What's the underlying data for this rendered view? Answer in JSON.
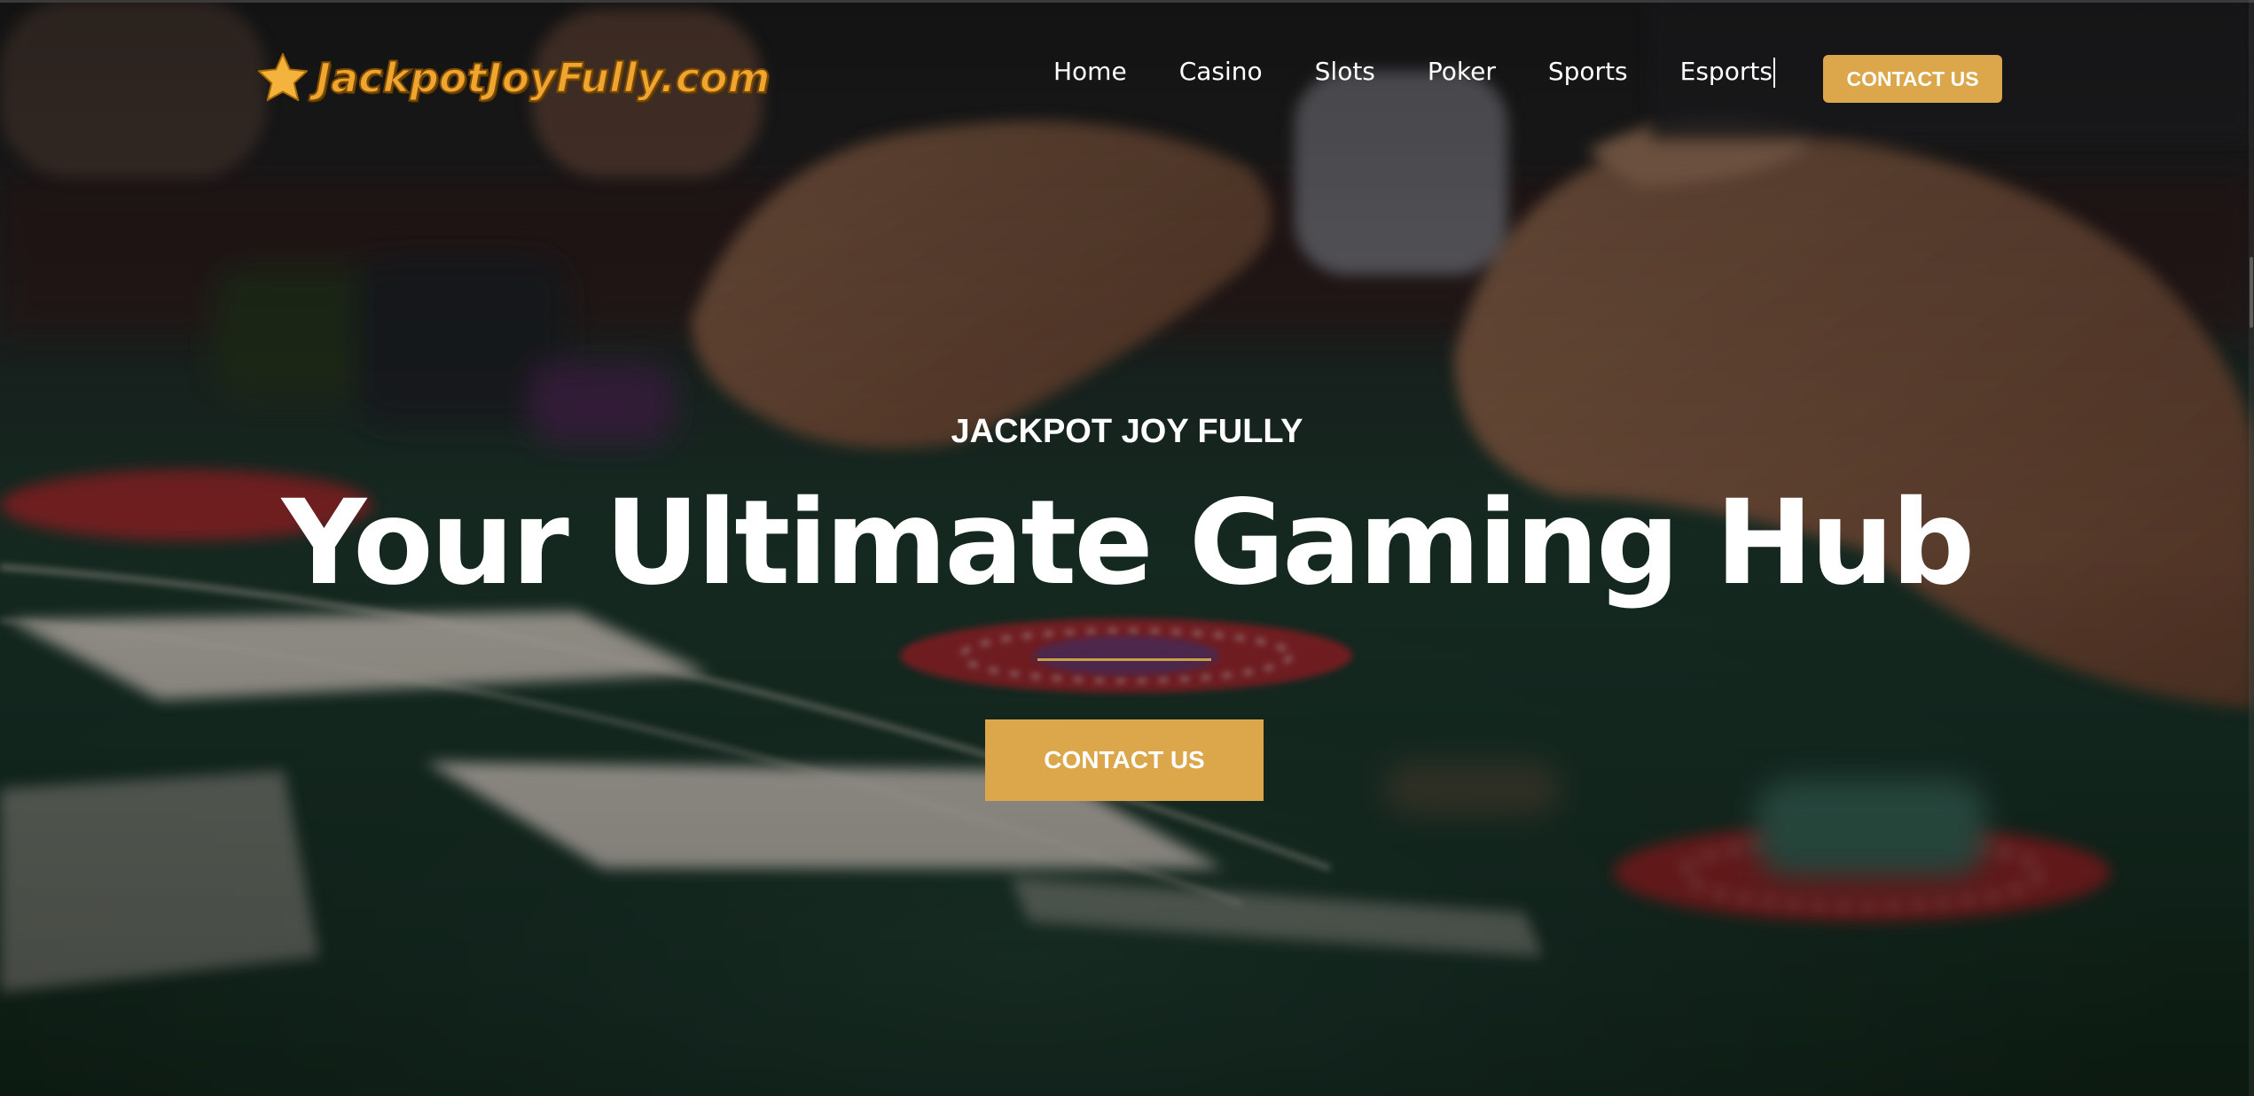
{
  "brand": {
    "logo_text": "JackpotJoyFully.com",
    "logo_icon": "star-icon",
    "logo_color": "#f0a531"
  },
  "nav": {
    "items": [
      {
        "label": "Home"
      },
      {
        "label": "Casino"
      },
      {
        "label": "Slots"
      },
      {
        "label": "Poker"
      },
      {
        "label": "Sports"
      },
      {
        "label": "Esports"
      }
    ],
    "contact_label": "CONTACT US"
  },
  "hero": {
    "eyebrow": "JACKPOT JOY FULLY",
    "headline": "Your Ultimate Gaming Hub",
    "cta_label": "CONTACT US",
    "background": "casino-table-photo"
  },
  "colors": {
    "accent": "#dca64a",
    "text": "#ffffff",
    "felt": "#1e3d30"
  }
}
